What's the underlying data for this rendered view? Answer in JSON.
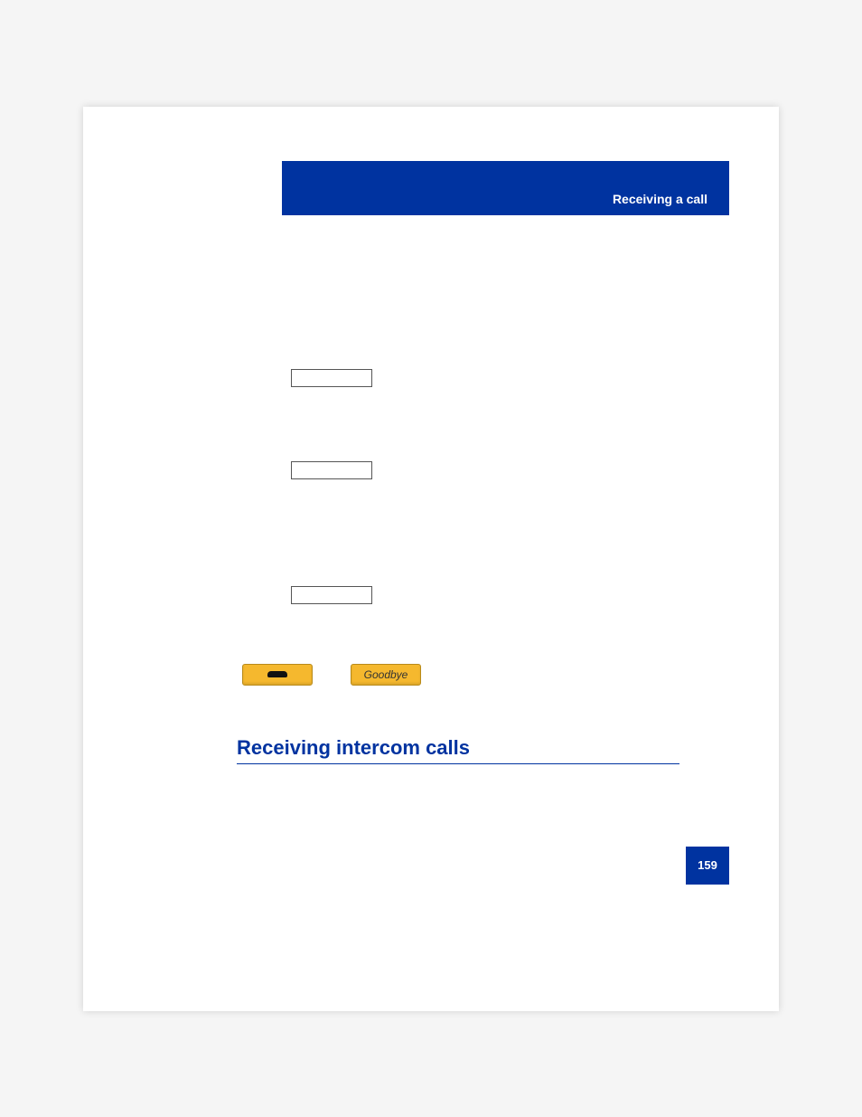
{
  "header": {
    "section_title": "Receiving a call"
  },
  "buttons": {
    "goodbye_label": "Goodbye",
    "hangup_icon": "phone-hangup-icon"
  },
  "section_heading": "Receiving intercom calls",
  "page_number": "159"
}
